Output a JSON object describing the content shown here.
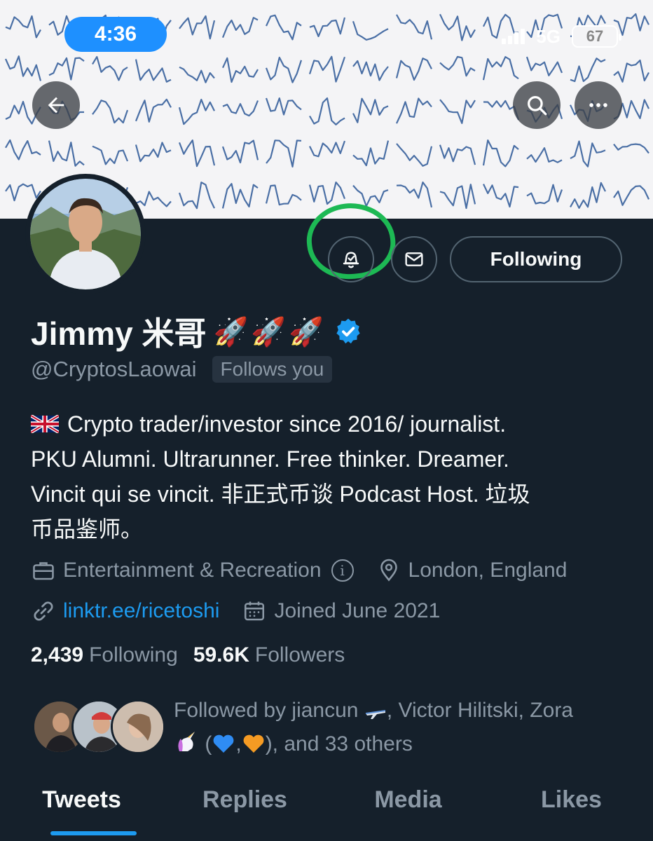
{
  "status_bar": {
    "time": "4:36",
    "network": "5G",
    "battery": "67"
  },
  "header": {
    "back_icon": "back-arrow-icon",
    "search_icon": "search-icon",
    "more_icon": "more-icon"
  },
  "actions": {
    "notify_icon": "bell-check-icon",
    "message_icon": "envelope-icon",
    "follow_label": "Following"
  },
  "profile": {
    "name": "Jimmy 米哥",
    "name_emojis": "🚀🚀🚀",
    "handle": "@CryptosLaowai",
    "follows_you": "Follows you",
    "bio": {
      "line1": "Crypto trader/investor since 2016/ journalist.",
      "line2": "PKU Alumni. Ultrarunner. Free thinker. Dreamer.",
      "line3": "Vincit qui se vincit. 非正式币谈 Podcast Host. 垃圾",
      "line4": "币品鉴师。"
    },
    "category": "Entertainment & Recreation",
    "location": "London, England",
    "website": "linktr.ee/ricetoshi",
    "joined": "Joined June 2021"
  },
  "stats": {
    "following_count": "2,439",
    "following_label": "Following",
    "followers_count": "59.6K",
    "followers_label": "Followers"
  },
  "followed_by": {
    "part1": "Followed by jiancun",
    "part2": ", Victor Hilitski, Zora",
    "part3": "(",
    "part4": ",",
    "part5": "), and 33 others"
  },
  "tabs": [
    {
      "label": "Tweets",
      "active": true
    },
    {
      "label": "Replies",
      "active": false
    },
    {
      "label": "Media",
      "active": false
    },
    {
      "label": "Likes",
      "active": false
    }
  ],
  "colors": {
    "background": "#15202b",
    "accent": "#1d9bf0",
    "muted": "#8b98a5",
    "highlight_ring": "#1db954"
  }
}
